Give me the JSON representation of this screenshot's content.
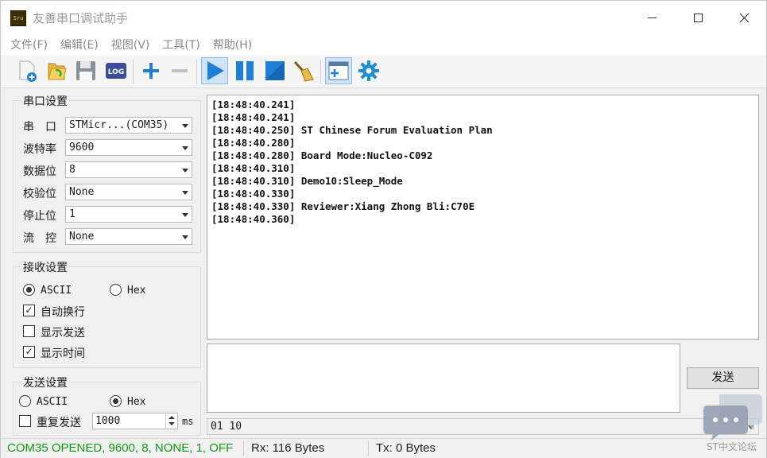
{
  "window": {
    "app_icon_text": "Sru",
    "title": "友善串口调试助手",
    "minimize_glyph": "—",
    "maximize_glyph": "☐",
    "close_glyph": "✕"
  },
  "menu": [
    "文件(F)",
    "编辑(E)",
    "视图(V)",
    "工具(T)",
    "帮助(H)"
  ],
  "toolbar": {
    "icons": [
      "new-file-icon",
      "open-folder-icon",
      "save-icon",
      "log-icon",
      "add-icon",
      "remove-icon",
      "play-icon",
      "pause-icon",
      "stop-icon",
      "clear-broom-icon",
      "new-window-icon",
      "settings-gear-icon"
    ],
    "log_label": "LOG"
  },
  "serial": {
    "title": "串口设置",
    "fields": [
      {
        "label": "串　口",
        "value": "STMicr...(COM35)"
      },
      {
        "label": "波特率",
        "value": "9600"
      },
      {
        "label": "数据位",
        "value": "8"
      },
      {
        "label": "校验位",
        "value": "None"
      },
      {
        "label": "停止位",
        "value": "1"
      },
      {
        "label": "流　控",
        "value": "None"
      }
    ]
  },
  "receive_settings": {
    "title": "接收设置",
    "ascii_label": "ASCII",
    "hex_label": "Hex",
    "auto_newline": "自动换行",
    "show_send": "显示发送",
    "show_time": "显示时间",
    "check_mark": "✓"
  },
  "send_settings": {
    "title": "发送设置",
    "ascii_label": "ASCII",
    "hex_label": "Hex",
    "repeat_label": "重复发送",
    "interval": "1000",
    "unit": "ms"
  },
  "receive_log": [
    "[18:48:40.241]",
    "[18:48:40.241]",
    "[18:48:40.250] ST Chinese Forum Evaluation Plan",
    "[18:48:40.280]",
    "[18:48:40.280] Board Mode:Nucleo-C092",
    "[18:48:40.310]",
    "[18:48:40.310] Demo10:Sleep_Mode",
    "[18:48:40.330]",
    "[18:48:40.330] Reviewer:Xiang Zhong Bli:C70E",
    "[18:48:40.360]"
  ],
  "send": {
    "button": "发送",
    "history_value": "01 10"
  },
  "status": {
    "connection": "COM35 OPENED, 9600, 8, NONE, 1, OFF",
    "rx": "Rx: 116 Bytes",
    "tx": "Tx: 0 Bytes"
  },
  "watermark": "ST中文论坛",
  "colors": {
    "status_ok": "#119911",
    "accent_blue": "#1e7fd6"
  }
}
